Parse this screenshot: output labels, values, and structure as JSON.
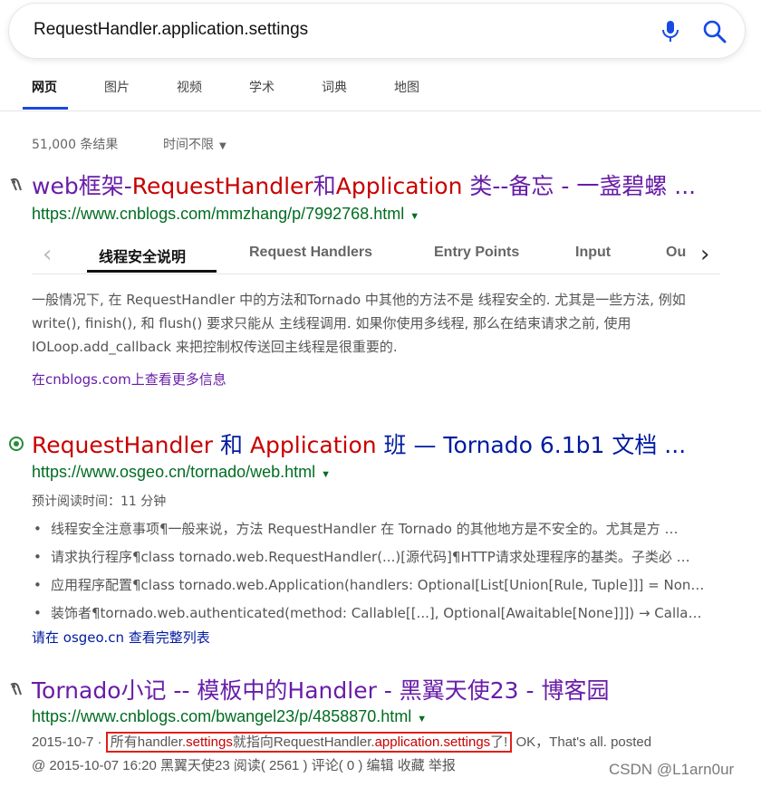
{
  "search": {
    "query": "RequestHandler.application.settings"
  },
  "tabs": [
    "网页",
    "图片",
    "视频",
    "学术",
    "词典",
    "地图"
  ],
  "results_meta": {
    "count": "51,000 条结果",
    "time_filter": "时间不限"
  },
  "result1": {
    "title_a": "web框架-",
    "title_b": "RequestHandler",
    "title_c": "和",
    "title_d": "Application",
    "title_e": " 类--备忘 - 一盏碧螺 ...",
    "url": "https://www.cnblogs.com/mmzhang/p/7992768.html",
    "subtabs": [
      "线程安全说明",
      "Request Handlers",
      "Entry Points",
      "Input",
      "Ou"
    ],
    "snippet_lines": [
      "一般情况下, 在 RequestHandler 中的方法和Tornado 中其他的方法不是 线程安全的. 尤其是一些方法, 例如",
      "write(), finish(), 和 flush() 要求只能从 主线程调用. 如果你使用多线程, 那么在结束请求之前, 使用",
      "IOLoop.add_callback 来把控制权传送回主线程是很重要的."
    ],
    "more_link": "在cnblogs.com上查看更多信息"
  },
  "result2": {
    "title_a": "RequestHandler",
    "title_b": " 和 ",
    "title_c": "Application",
    "title_d": " 班 — Tornado 6.1b1 文档 ...",
    "url": "https://www.osgeo.cn/tornado/web.html",
    "read_time": "预计阅读时间：11 分钟",
    "bullets": [
      "线程安全注意事项¶一般来说，方法 RequestHandler 在 Tornado 的其他地方是不安全的。尤其是方 …",
      "请求执行程序¶class tornado.web.RequestHandler(...)[源代码]¶HTTP请求处理程序的基类。子类必 …",
      "应用程序配置¶class tornado.web.Application(handlers: Optional[List[Union[Rule, Tuple]]] = None, …",
      "装饰者¶tornado.web.authenticated(method: Callable[[...], Optional[Awaitable[None]]]) → Callable[[...]"
    ],
    "full_list_link": "请在 osgeo.cn 查看完整列表"
  },
  "result3": {
    "title": "Tornado小记 -- 模板中的Handler - 黑翼天使23 - 博客园",
    "url": "https://www.cnblogs.com/bwangel23/p/4858870.html",
    "date": "2015-10-7",
    "sep": " · ",
    "box_a": "所有handler.",
    "box_b": "settings",
    "box_c": "就指向RequestHandler.",
    "box_d": "application.settings",
    "box_e": "了!",
    "after_box": " OK，That's all. posted",
    "line2": "@ 2015-10-07 16:20 黑翼天使23 阅读( 2561 ) 评论( 0 ) 编辑 收藏 举报"
  },
  "watermark": "CSDN @L1arn0ur",
  "colors": {
    "accent": "#174ae4",
    "visited": "#681da8",
    "hit": "#c80000",
    "link": "#001ba0",
    "url": "#006d21"
  }
}
